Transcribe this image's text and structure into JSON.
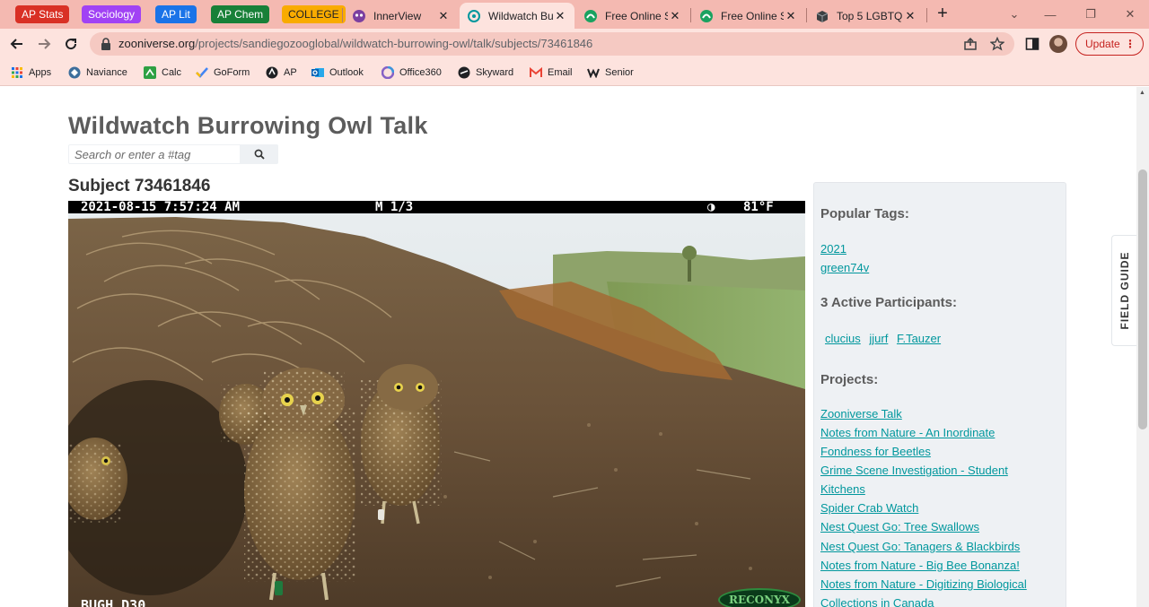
{
  "tab_groups": [
    {
      "label": "AP Stats",
      "color": "#d93025"
    },
    {
      "label": "Sociology",
      "color": "#a142f4"
    },
    {
      "label": "AP Lit",
      "color": "#1a73e8"
    },
    {
      "label": "AP Chem",
      "color": "#188038"
    },
    {
      "label": "COLLEGE",
      "color": "#f9ab00"
    }
  ],
  "tabs": [
    {
      "title": "InnerView",
      "icon": "innerview-icon",
      "active": false
    },
    {
      "title": "Wildwatch Bu",
      "icon": "zooniverse-icon",
      "active": true
    },
    {
      "title": "Free Online S",
      "icon": "course-icon",
      "active": false
    },
    {
      "title": "Free Online S",
      "icon": "course-icon",
      "active": false
    },
    {
      "title": "Top 5 LGBTQ",
      "icon": "box-icon",
      "active": false
    }
  ],
  "window_controls": {
    "minimize": "—",
    "restore": "❐",
    "close": "✕",
    "tab_search": "⌄"
  },
  "toolbar": {
    "url_host": "zooniverse.org",
    "url_path": "/projects/sandiegozooglobal/wildwatch-burrowing-owl/talk/subjects/73461846",
    "update_label": "Update",
    "update_menu": "⋮"
  },
  "bookmarks": [
    {
      "label": "Apps",
      "icon": "apps-grid-icon"
    },
    {
      "label": "Naviance",
      "icon": "naviance-icon"
    },
    {
      "label": "Calc",
      "icon": "calc-icon"
    },
    {
      "label": "GoForm",
      "icon": "goform-icon"
    },
    {
      "label": "AP",
      "icon": "ap-icon"
    },
    {
      "label": "Outlook",
      "icon": "outlook-icon"
    },
    {
      "label": "Office360",
      "icon": "office-icon"
    },
    {
      "label": "Skyward",
      "icon": "skyward-icon"
    },
    {
      "label": "Email",
      "icon": "gmail-icon"
    },
    {
      "label": "Senior",
      "icon": "senior-icon"
    }
  ],
  "page": {
    "title": "Wildwatch Burrowing Owl Talk",
    "search_placeholder": "Search or enter a #tag",
    "search_icon": "search-icon",
    "subject_heading": "Subject 73461846",
    "image": {
      "timestamp": "2021-08-15 7:57:24 AM",
      "frame": "M 1/3",
      "moon": "◑",
      "temperature": "81°F",
      "bottom_label": "BUGH D30",
      "brand": "RECONYX"
    }
  },
  "sidebar": {
    "popular_tags_heading": "Popular Tags:",
    "tags": [
      "2021",
      "green74v"
    ],
    "participants_heading": "3 Active Participants:",
    "participants": [
      "clucius",
      "jjurf",
      "F.Tauzer"
    ],
    "projects_heading": "Projects:",
    "projects": [
      "Zooniverse Talk",
      "Notes from Nature - An Inordinate",
      "Fondness for Beetles",
      "Grime Scene Investigation - Student",
      "Kitchens",
      "Spider Crab Watch",
      "Nest Quest Go: Tree Swallows",
      "Nest Quest Go: Tanagers & Blackbirds",
      "Notes from Nature - Big Bee Bonanza!",
      "Notes from Nature - Digitizing Biological",
      "Collections in Canada"
    ]
  },
  "field_guide_label": "FIELD GUIDE"
}
